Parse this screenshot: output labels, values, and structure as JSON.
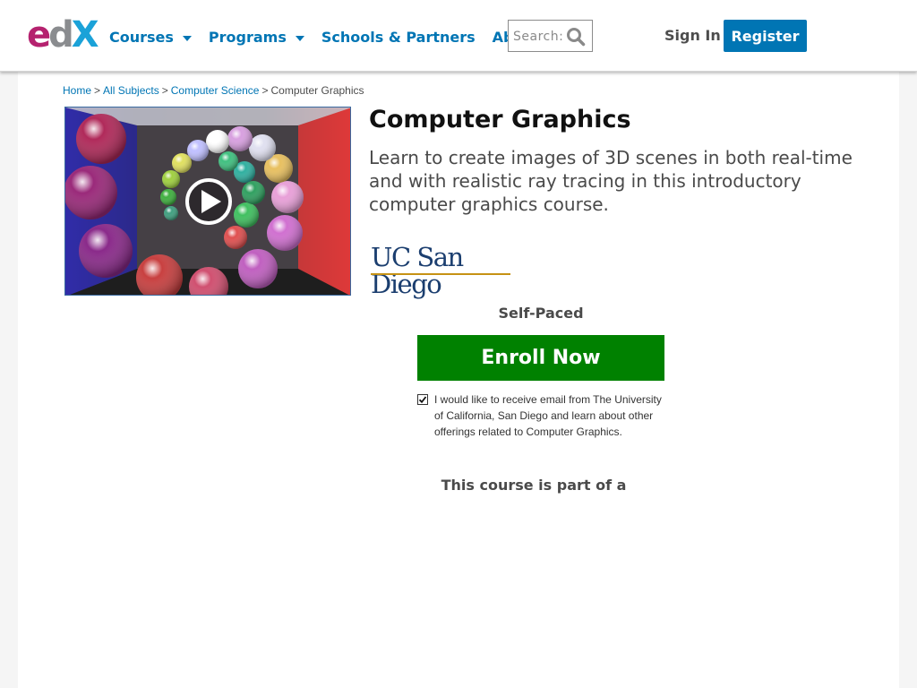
{
  "header": {
    "logo": {
      "e": "e",
      "d": "d",
      "x": "X"
    },
    "nav": [
      {
        "label": "Courses",
        "has_dropdown": true
      },
      {
        "label": "Programs",
        "has_dropdown": true
      },
      {
        "label": "Schools & Partners",
        "has_dropdown": false
      },
      {
        "label": "About",
        "has_dropdown": true
      }
    ],
    "search": {
      "placeholder": "Search:",
      "value": ""
    },
    "signin_label": "Sign In",
    "register_label": "Register"
  },
  "breadcrumb": {
    "items": [
      "Home",
      "All Subjects",
      "Computer Science"
    ],
    "current": "Computer Graphics",
    "separator": ">"
  },
  "course": {
    "title": "Computer Graphics",
    "subtitle": "Learn to create images of 3D scenes in both real-time and with realistic ray tracing in this introductory computer graphics course.",
    "school_logo": "UC San Diego",
    "pacing": "Self-Paced",
    "enroll_label": "Enroll Now",
    "email_consent_checked": true,
    "email_consent_text": "I would like to receive email from The University of California, San Diego and learn about other offerings related to Computer Graphics.",
    "program_note": "This course is part of a"
  },
  "icons": {
    "search": "search-icon",
    "caret": "chevron-down-icon",
    "play": "play-icon",
    "check": "check-icon"
  },
  "colors": {
    "link": "#0075b4",
    "register_bg": "#0075b4",
    "enroll_bg": "#008100",
    "logo_e": "#b5226f",
    "logo_d": "#8a8c8f",
    "logo_x": "#1ba2d8",
    "ucsd_navy": "#1b3e6f",
    "ucsd_gold": "#c69214"
  }
}
